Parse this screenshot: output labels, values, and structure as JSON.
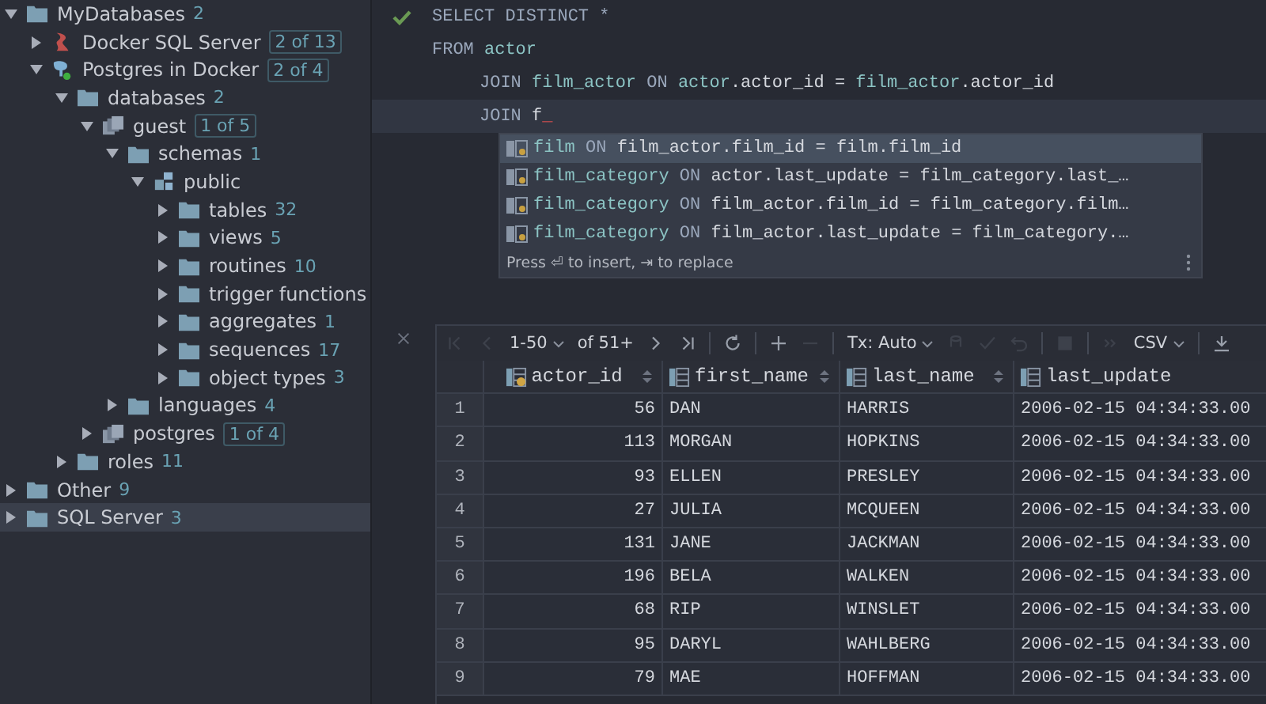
{
  "tree": [
    {
      "label": "MyDatabases",
      "count": "2",
      "kind": "folder",
      "expanded": true,
      "selected": false,
      "children": [
        {
          "label": "Docker SQL Server",
          "badge": "2 of 13",
          "kind": "sqlserver",
          "expanded": false,
          "selected": false
        },
        {
          "label": "Postgres in Docker",
          "badge": "2 of 4",
          "kind": "postgres",
          "expanded": true,
          "selected": false,
          "children": [
            {
              "label": "databases",
              "count": "2",
              "kind": "folder",
              "expanded": true,
              "selected": false,
              "children": [
                {
                  "label": "guest",
                  "badge": "1 of 5",
                  "kind": "database",
                  "expanded": true,
                  "selected": false,
                  "children": [
                    {
                      "label": "schemas",
                      "count": "1",
                      "kind": "folder",
                      "expanded": true,
                      "selected": false,
                      "children": [
                        {
                          "label": "public",
                          "kind": "schema",
                          "expanded": true,
                          "selected": false,
                          "children": [
                            {
                              "label": "tables",
                              "count": "32",
                              "kind": "folder",
                              "expanded": false,
                              "selected": false
                            },
                            {
                              "label": "views",
                              "count": "5",
                              "kind": "folder",
                              "expanded": false,
                              "selected": false
                            },
                            {
                              "label": "routines",
                              "count": "10",
                              "kind": "folder",
                              "expanded": false,
                              "selected": false
                            },
                            {
                              "label": "trigger functions",
                              "kind": "folder",
                              "expanded": false,
                              "selected": false
                            },
                            {
                              "label": "aggregates",
                              "count": "1",
                              "kind": "folder",
                              "expanded": false,
                              "selected": false
                            },
                            {
                              "label": "sequences",
                              "count": "17",
                              "kind": "folder",
                              "expanded": false,
                              "selected": false
                            },
                            {
                              "label": "object types",
                              "count": "3",
                              "kind": "folder",
                              "expanded": false,
                              "selected": false
                            }
                          ]
                        }
                      ]
                    },
                    {
                      "label": "languages",
                      "count": "4",
                      "kind": "folder",
                      "expanded": false,
                      "selected": false
                    }
                  ]
                },
                {
                  "label": "postgres",
                  "badge": "1 of 4",
                  "kind": "database",
                  "expanded": false,
                  "selected": false
                }
              ]
            },
            {
              "label": "roles",
              "count": "11",
              "kind": "folder",
              "expanded": false,
              "selected": false
            }
          ]
        }
      ]
    },
    {
      "label": "Other",
      "count": "9",
      "kind": "folder",
      "expanded": false,
      "selected": false
    },
    {
      "label": "SQL Server",
      "count": "3",
      "kind": "folder",
      "expanded": false,
      "selected": true
    }
  ],
  "code": [
    {
      "indented": false,
      "current": false,
      "checked": true,
      "tokens": [
        {
          "kind": "keyword",
          "text": "SELECT DISTINCT *"
        }
      ]
    },
    {
      "indented": false,
      "current": false,
      "checked": false,
      "tokens": [
        {
          "kind": "keyword",
          "text": "FROM"
        },
        {
          "kind": "ident",
          "text": " actor"
        }
      ]
    },
    {
      "indented": true,
      "current": false,
      "checked": false,
      "tokens": [
        {
          "kind": "keyword",
          "text": "JOIN"
        },
        {
          "kind": "ident",
          "text": " film_actor"
        },
        {
          "kind": "keyword",
          "text": " ON"
        },
        {
          "kind": "ident",
          "text": " actor"
        },
        {
          "kind": "plain",
          "text": ".actor_id = "
        },
        {
          "kind": "ident",
          "text": "film_actor"
        },
        {
          "kind": "plain",
          "text": ".actor_id"
        }
      ]
    },
    {
      "indented": true,
      "current": true,
      "checked": false,
      "tokens": [
        {
          "kind": "keyword",
          "text": "JOIN"
        },
        {
          "kind": "plain",
          "text": " f"
        },
        {
          "kind": "error",
          "text": "_"
        }
      ]
    }
  ],
  "completion": {
    "items": [
      {
        "selected": true,
        "tokens": [
          {
            "kind": "ident",
            "text": "film"
          },
          {
            "kind": "keyword",
            "text": " ON"
          },
          {
            "kind": "plain",
            "text": " film_actor.film_id = film.film_id"
          }
        ]
      },
      {
        "selected": false,
        "tokens": [
          {
            "kind": "ident",
            "text": "film_category"
          },
          {
            "kind": "keyword",
            "text": " ON"
          },
          {
            "kind": "plain",
            "text": " actor.last_update = film_category.last_…"
          }
        ]
      },
      {
        "selected": false,
        "tokens": [
          {
            "kind": "ident",
            "text": "film_category"
          },
          {
            "kind": "keyword",
            "text": " ON"
          },
          {
            "kind": "plain",
            "text": " film_actor.film_id = film_category.film…"
          }
        ]
      },
      {
        "selected": false,
        "tokens": [
          {
            "kind": "ident",
            "text": "film_category"
          },
          {
            "kind": "keyword",
            "text": " ON"
          },
          {
            "kind": "plain",
            "text": " film_actor.last_update = film_category.…"
          }
        ]
      }
    ],
    "hint": "Press ⏎ to insert, ⇥ to replace"
  },
  "results": {
    "toolbar": [
      [
        {
          "kind": "first",
          "disabled": true
        },
        {
          "kind": "prev",
          "disabled": true
        },
        {
          "kind": "dropdown",
          "label": "1-50",
          "disabled": false
        },
        {
          "kind": "text",
          "label": "of 51+"
        },
        {
          "kind": "next",
          "disabled": false
        },
        {
          "kind": "last",
          "disabled": false
        }
      ],
      [
        {
          "kind": "refresh",
          "disabled": false
        }
      ],
      [
        {
          "kind": "add",
          "disabled": false
        },
        {
          "kind": "remove",
          "disabled": true
        }
      ],
      [
        {
          "kind": "dropdown",
          "label": "Tx: Auto",
          "disabled": false
        },
        {
          "kind": "db",
          "disabled": true
        },
        {
          "kind": "commit",
          "disabled": true
        },
        {
          "kind": "rollback",
          "disabled": true
        }
      ],
      [
        {
          "kind": "stop",
          "disabled": true
        }
      ],
      [
        {
          "kind": "more",
          "disabled": true
        },
        {
          "kind": "dropdown",
          "label": "CSV",
          "disabled": false
        }
      ],
      [
        {
          "kind": "download",
          "disabled": false
        }
      ]
    ],
    "columns": [
      {
        "label": "actor_id",
        "key": true,
        "sortable": true
      },
      {
        "label": "first_name",
        "key": false,
        "sortable": true
      },
      {
        "label": "last_name",
        "key": false,
        "sortable": true
      },
      {
        "label": "last_update",
        "key": false,
        "sortable": false
      }
    ],
    "rows": [
      {
        "number": "1",
        "cells": [
          "56",
          "DAN",
          "HARRIS",
          "2006-02-15 04:34:33.00"
        ]
      },
      {
        "number": "2",
        "cells": [
          "113",
          "MORGAN",
          "HOPKINS",
          "2006-02-15 04:34:33.00"
        ]
      },
      {
        "number": "3",
        "cells": [
          "93",
          "ELLEN",
          "PRESLEY",
          "2006-02-15 04:34:33.00"
        ]
      },
      {
        "number": "4",
        "cells": [
          "27",
          "JULIA",
          "MCQUEEN",
          "2006-02-15 04:34:33.00"
        ]
      },
      {
        "number": "5",
        "cells": [
          "131",
          "JANE",
          "JACKMAN",
          "2006-02-15 04:34:33.00"
        ]
      },
      {
        "number": "6",
        "cells": [
          "196",
          "BELA",
          "WALKEN",
          "2006-02-15 04:34:33.00"
        ]
      },
      {
        "number": "7",
        "cells": [
          "68",
          "RIP",
          "WINSLET",
          "2006-02-15 04:34:33.00"
        ]
      },
      {
        "number": "8",
        "cells": [
          "95",
          "DARYL",
          "WAHLBERG",
          "2006-02-15 04:34:33.00"
        ]
      },
      {
        "number": "9",
        "cells": [
          "79",
          "MAE",
          "HOFFMAN",
          "2006-02-15 04:34:33.00"
        ]
      }
    ]
  }
}
